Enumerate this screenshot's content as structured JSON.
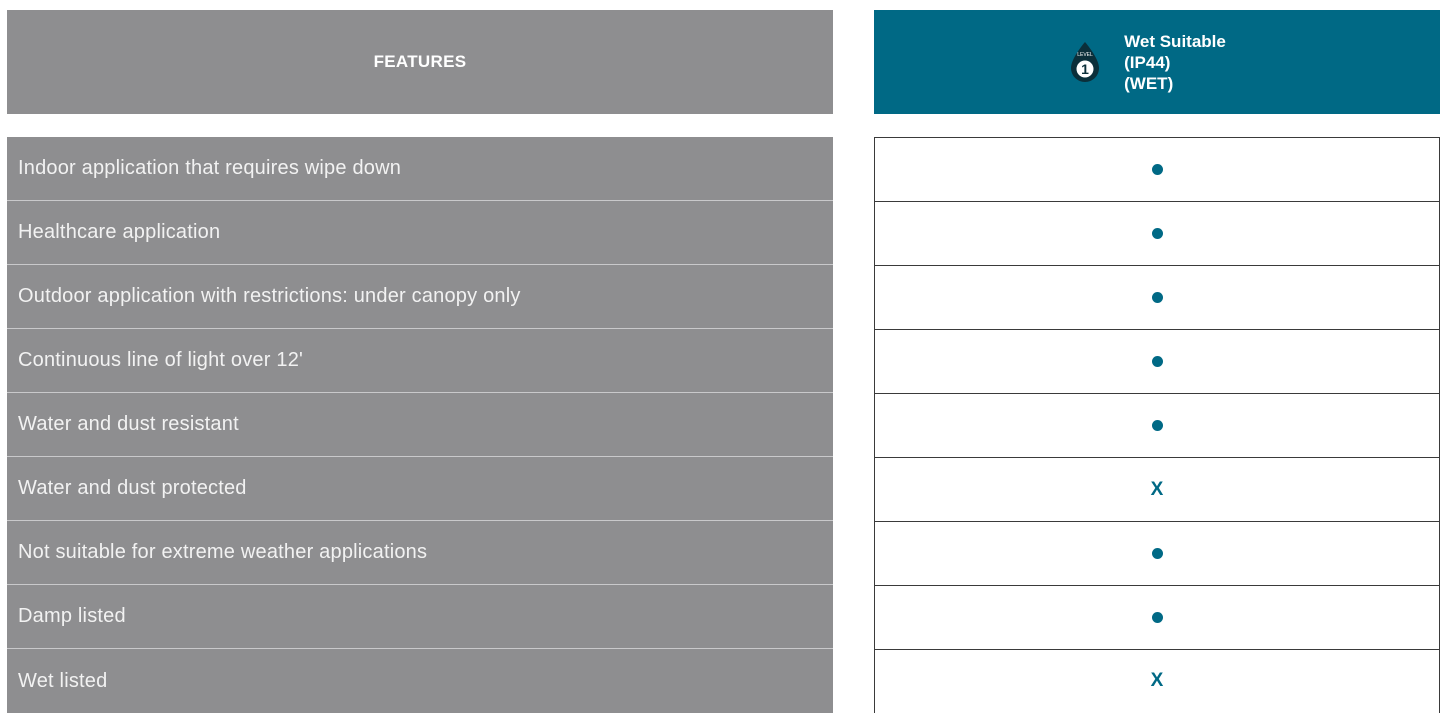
{
  "header": {
    "features_label": "FEATURES",
    "level_badge_text": "LEVEL",
    "level_number": "1",
    "level_title_lines": [
      "Wet Suitable",
      "(IP44)",
      "(WET)"
    ]
  },
  "colors": {
    "teal": "#006985",
    "gray": "#8e8e90"
  },
  "rows": [
    {
      "feature": "Indoor application that requires wipe down",
      "value": "dot"
    },
    {
      "feature": "Healthcare application",
      "value": "dot"
    },
    {
      "feature": "Outdoor application with restrictions: under canopy only",
      "value": "dot"
    },
    {
      "feature": "Continuous line of light over 12'",
      "value": "dot"
    },
    {
      "feature": "Water and dust resistant",
      "value": "dot"
    },
    {
      "feature": "Water and dust protected",
      "value": "x",
      "mark": "X"
    },
    {
      "feature": "Not suitable for extreme weather applications",
      "value": "dot"
    },
    {
      "feature": "Damp listed",
      "value": "dot"
    },
    {
      "feature": "Wet listed",
      "value": "x",
      "mark": "X"
    }
  ]
}
